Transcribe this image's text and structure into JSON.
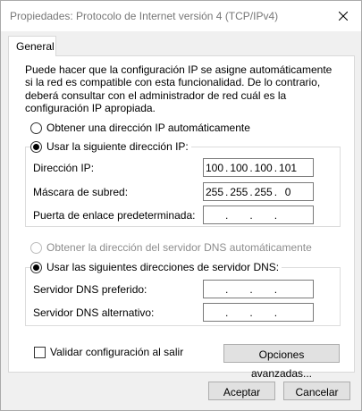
{
  "window": {
    "title": "Propiedades: Protocolo de Internet versión 4 (TCP/IPv4)",
    "close_icon": "close-icon"
  },
  "tabs": [
    {
      "label": "General",
      "selected": true
    }
  ],
  "description": "Puede hacer que la configuración IP se asigne automáticamente si la red es compatible con esta funcionalidad. De lo contrario, deberá consultar con el administrador de red cuál es la configuración IP apropiada.",
  "ip": {
    "auto_label": "Obtener una dirección IP automáticamente",
    "auto_selected": false,
    "manual_label": "Usar la siguiente dirección IP:",
    "manual_selected": true,
    "fields": [
      {
        "label": "Dirección IP:",
        "octets": [
          "100",
          "100",
          "100",
          "101"
        ]
      },
      {
        "label": "Máscara de subred:",
        "octets": [
          "255",
          "255",
          "255",
          "0"
        ]
      },
      {
        "label": "Puerta de enlace predeterminada:",
        "octets": [
          "",
          "",
          "",
          ""
        ]
      }
    ]
  },
  "dns": {
    "auto_label": "Obtener la dirección del servidor DNS automáticamente",
    "auto_selected": false,
    "auto_disabled": true,
    "manual_label": "Usar las siguientes direcciones de servidor DNS:",
    "manual_selected": true,
    "fields": [
      {
        "label": "Servidor DNS preferido:",
        "octets": [
          "",
          "",
          "",
          ""
        ]
      },
      {
        "label": "Servidor DNS alternativo:",
        "octets": [
          "",
          "",
          "",
          ""
        ]
      }
    ]
  },
  "validate": {
    "label": "Validar configuración al salir",
    "checked": false
  },
  "buttons": {
    "advanced": "Opciones avanzadas...",
    "accept": "Aceptar",
    "cancel": "Cancelar"
  }
}
